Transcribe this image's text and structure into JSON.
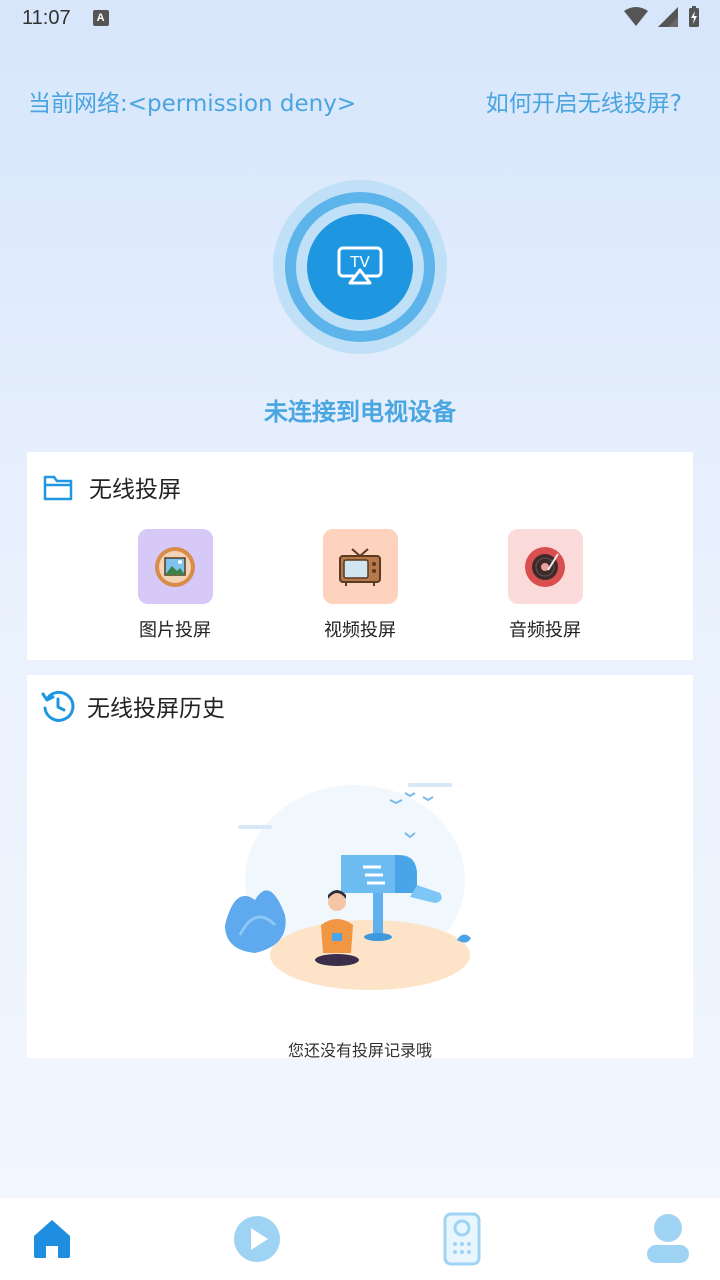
{
  "status_bar": {
    "time": "11:07",
    "notification_icon_letter": "A"
  },
  "header": {
    "network_label": "当前网络:<permission deny>",
    "help_link": "如何开启无线投屏?"
  },
  "cast": {
    "icon_text": "TV",
    "status": "未连接到电视设备"
  },
  "wireless_cast": {
    "title": "无线投屏",
    "items": [
      {
        "label": "图片投屏",
        "icon": "picture-icon",
        "bg": "#d6c8f7"
      },
      {
        "label": "视频投屏",
        "icon": "tv-icon",
        "bg": "#fdd3bd"
      },
      {
        "label": "音频投屏",
        "icon": "record-player-icon",
        "bg": "#fbdada"
      }
    ]
  },
  "history": {
    "title": "无线投屏历史",
    "empty_text": "您还没有投屏记录哦"
  },
  "bottom_nav": {
    "items": [
      {
        "name": "home",
        "icon": "home-icon",
        "active": true
      },
      {
        "name": "play",
        "icon": "play-icon",
        "active": false
      },
      {
        "name": "remote",
        "icon": "remote-icon",
        "active": false
      },
      {
        "name": "profile",
        "icon": "user-icon",
        "active": false
      }
    ]
  },
  "colors": {
    "accent": "#1f97e0",
    "accent_light": "#49a6e0",
    "nav_active": "#1f8ee0",
    "nav_inactive": "#9fd3f3"
  }
}
